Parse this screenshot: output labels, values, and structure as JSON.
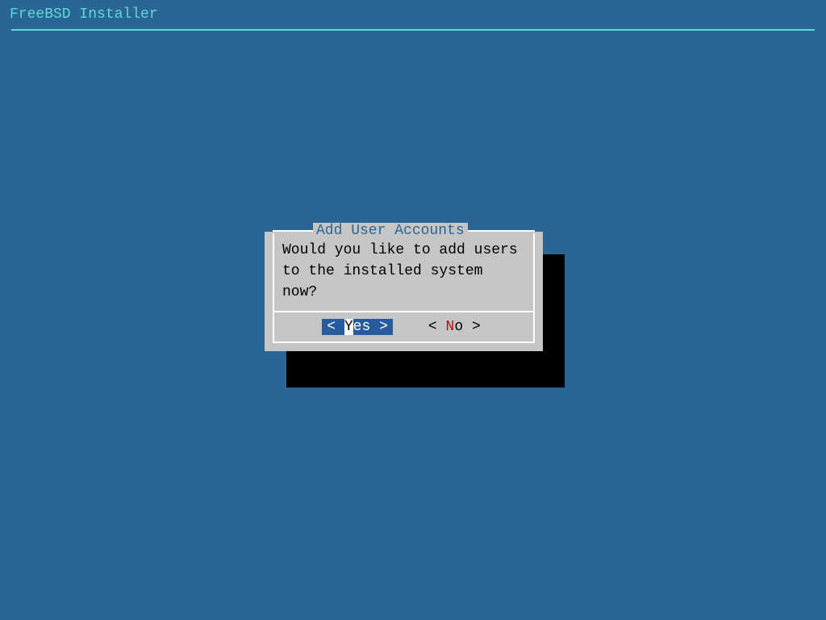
{
  "header": {
    "title": "FreeBSD Installer"
  },
  "dialog": {
    "title": "Add User Accounts",
    "message": "Would you like to add users to the installed system now?",
    "buttons": {
      "yes": {
        "open": "<",
        "hotkey": "Y",
        "rest": "es",
        "close": ">"
      },
      "no": {
        "open": "<",
        "hotkey": "N",
        "rest": "o",
        "close": ">"
      }
    }
  }
}
